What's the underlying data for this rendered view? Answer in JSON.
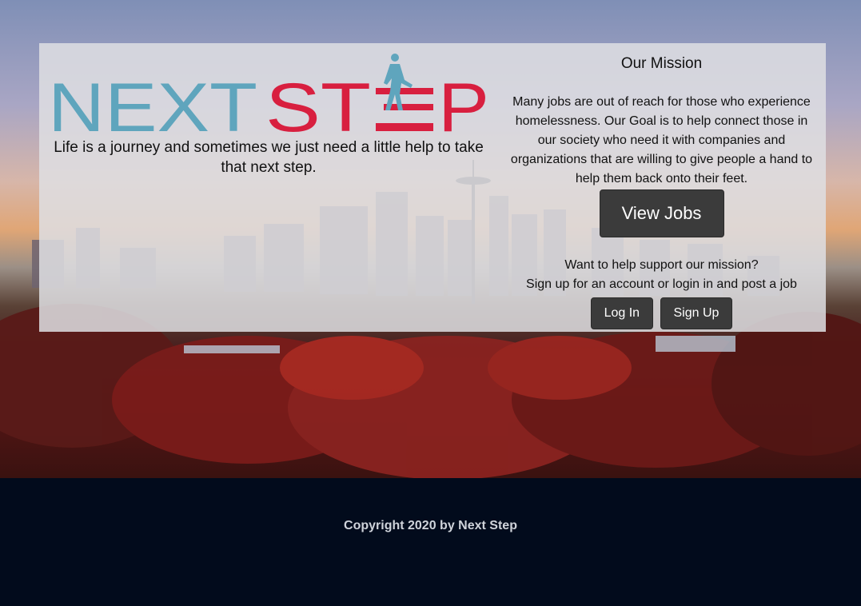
{
  "brand": {
    "logo_part1": "NEXT",
    "logo_part2": "ST",
    "logo_part3": "P",
    "color_primary": "#5fa5bd",
    "color_accent": "#d81f3f"
  },
  "hero": {
    "tagline": "Life is a journey and sometimes we just need a little help to take that next step."
  },
  "mission": {
    "title": "Our Mission",
    "text": "Many jobs are out of reach for those who experience homelessness. Our Goal is to help connect those in our society who need it with companies and organizations that are willing to give people a hand to help them back onto their feet.",
    "view_jobs_label": "View Jobs"
  },
  "support": {
    "line1": "Want to help support our mission?",
    "line2": "Sign up for an account or login in and post a job",
    "login_label": "Log In",
    "signup_label": "Sign Up"
  },
  "footer": {
    "copyright": "Copyright 2020 by Next Step"
  }
}
